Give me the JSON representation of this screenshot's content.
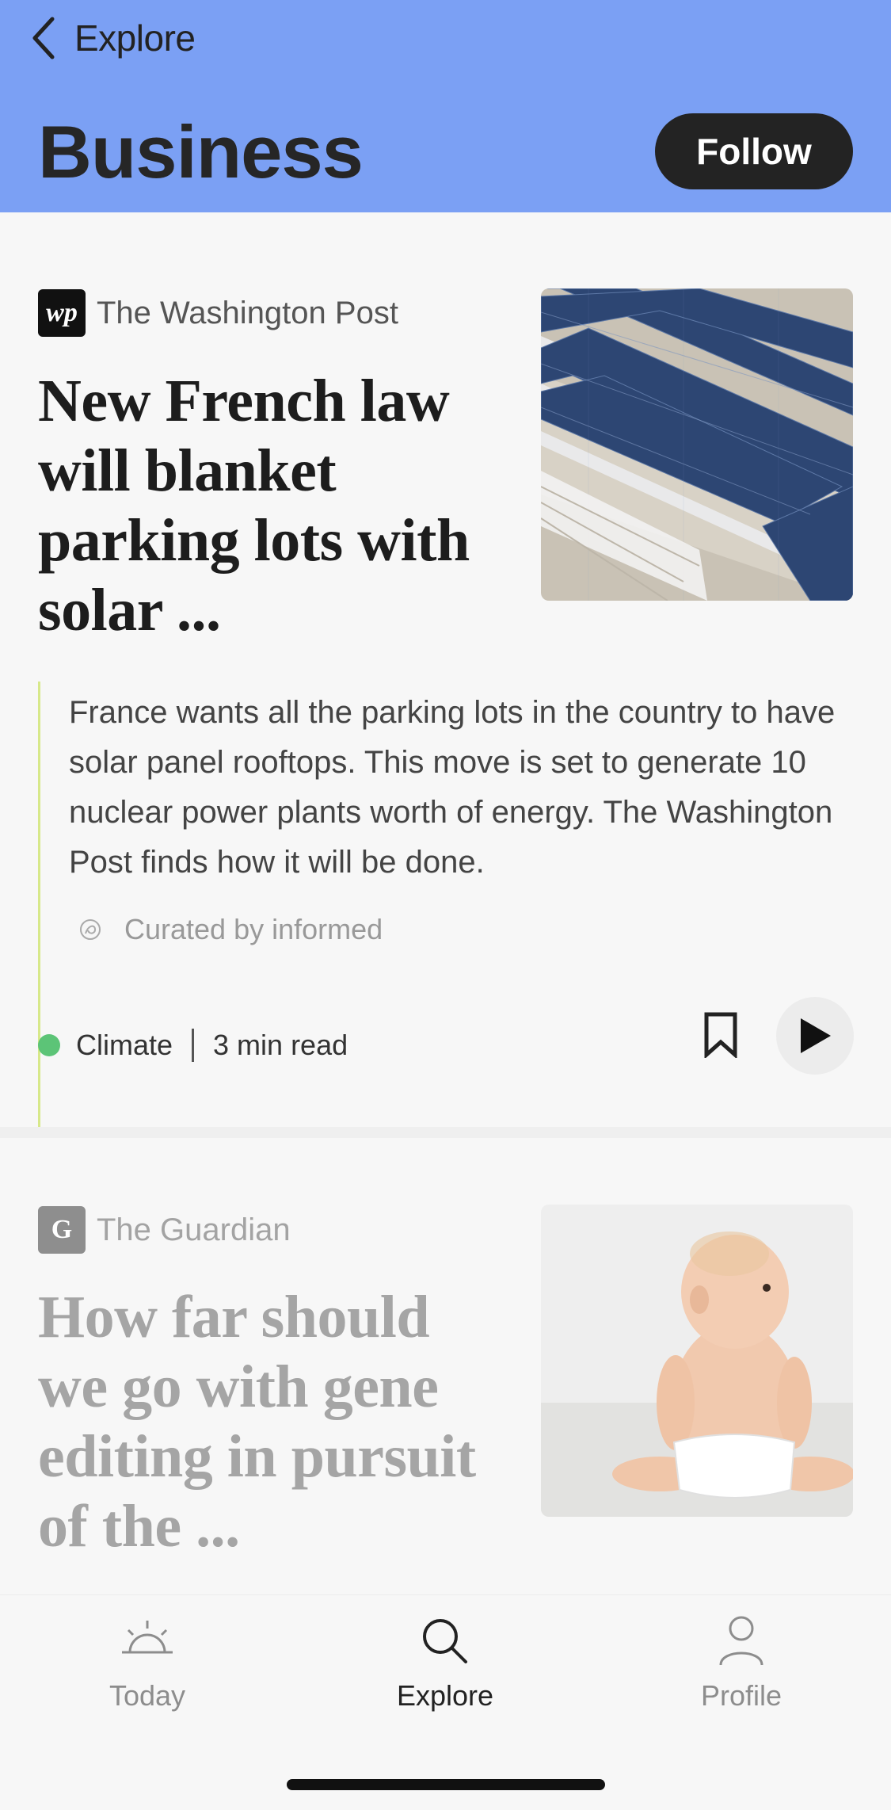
{
  "header": {
    "back_label": "Explore",
    "title": "Business",
    "follow_label": "Follow",
    "background_color": "#7ba0f4"
  },
  "articles": [
    {
      "source": "The Washington Post",
      "source_logo_text": "wp",
      "headline": "New French law will blanket parking lots with solar ...",
      "image": "solar-panels-parking-lot-image",
      "summary": "France wants all the parking lots in the country to have solar panel rooftops. This move is set to generate 10 nuclear power plants worth of energy. The Washington Post finds how it will be done.",
      "curated": "Curated by informed",
      "topic": "Climate",
      "topic_color": "#5cc477",
      "read_time": "3 min read"
    },
    {
      "source": "The Guardian",
      "source_logo_text": "G",
      "headline": "How far should we go with gene editing in pursuit of the ...",
      "image": "baby-sitting-image"
    }
  ],
  "nav": {
    "items": [
      {
        "label": "Today",
        "icon": "sunrise-icon",
        "active": false
      },
      {
        "label": "Explore",
        "icon": "search-icon",
        "active": true
      },
      {
        "label": "Profile",
        "icon": "person-icon",
        "active": false
      }
    ]
  }
}
